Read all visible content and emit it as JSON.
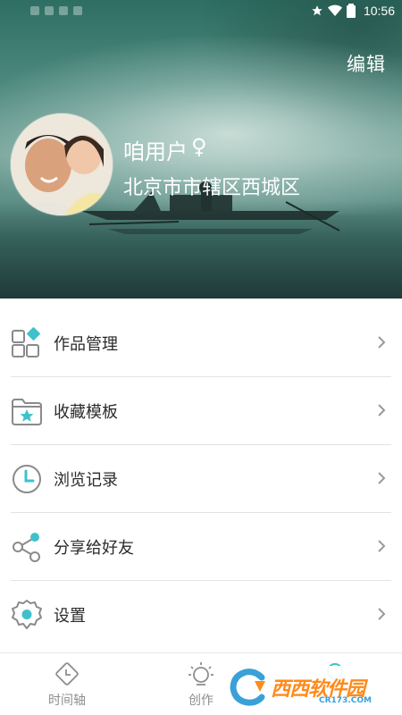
{
  "status_bar": {
    "time": "10:56"
  },
  "header": {
    "edit_label": "编辑",
    "user_name": "咱用户",
    "gender_symbol": "♀",
    "location": "北京市市辖区西城区"
  },
  "menu": {
    "items": [
      {
        "label": "作品管理",
        "icon": "works-grid-icon"
      },
      {
        "label": "收藏模板",
        "icon": "folder-star-icon"
      },
      {
        "label": "浏览记录",
        "icon": "clock-icon"
      },
      {
        "label": "分享给好友",
        "icon": "share-icon"
      },
      {
        "label": "设置",
        "icon": "gear-icon"
      }
    ]
  },
  "bottom_nav": {
    "tabs": [
      {
        "label": "时间轴",
        "icon": "timeline-icon",
        "active": false
      },
      {
        "label": "创作",
        "icon": "create-bulb-icon",
        "active": false
      },
      {
        "label": "",
        "icon": "profile-icon",
        "active": true
      }
    ]
  },
  "watermark": {
    "text": "西西软件园",
    "sub": "CR173.COM"
  },
  "colors": {
    "accent": "#3fc1cc",
    "icon_gray": "#8a8a8a",
    "text": "#2b2b2b",
    "divider": "#e3e3e3"
  }
}
